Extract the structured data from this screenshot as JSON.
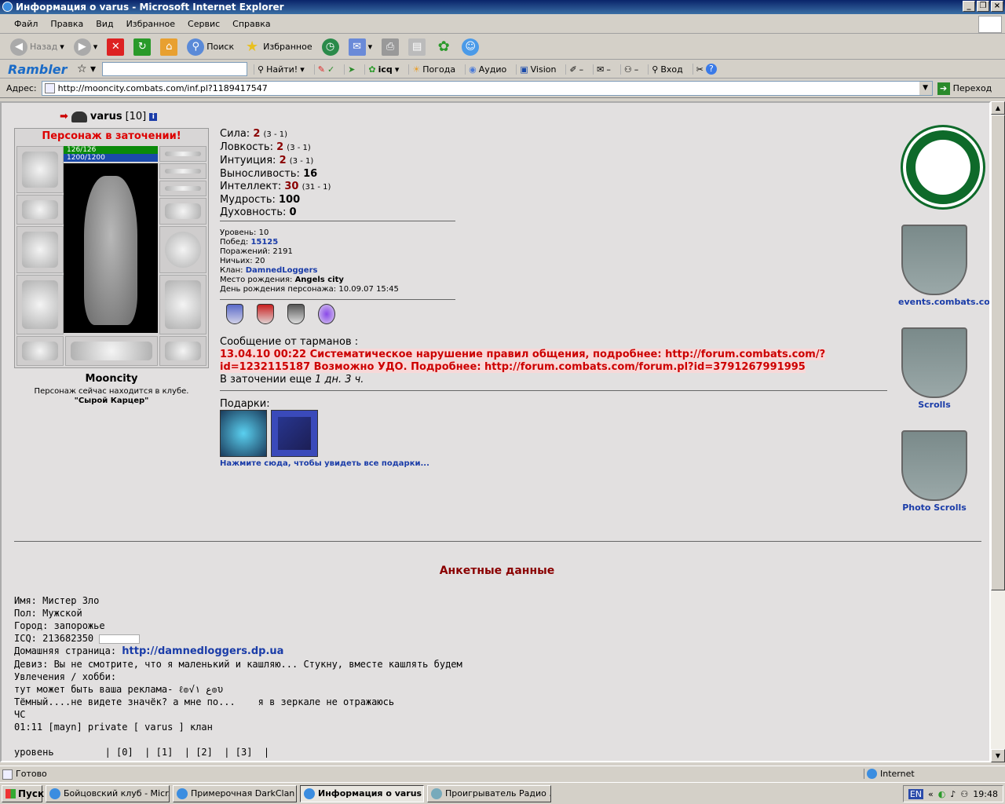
{
  "window": {
    "title": "Информация о varus - Microsoft Internet Explorer"
  },
  "menu": [
    "Файл",
    "Правка",
    "Вид",
    "Избранное",
    "Сервис",
    "Справка"
  ],
  "toolbar": {
    "back": "Назад",
    "search": "Поиск",
    "favorites": "Избранное"
  },
  "rambler": {
    "logo": "Rambler",
    "find": "Найти!",
    "icq": "icq",
    "weather": "Погода",
    "audio": "Аудио",
    "vision": "Vision",
    "login": "Вход"
  },
  "address": {
    "label": "Адрес:",
    "url": "http://mooncity.combats.com/inf.pl?1189417547",
    "go": "Переход"
  },
  "character": {
    "nick": "varus",
    "level": "[10]",
    "prison": "Персонаж в заточении!",
    "hp": "126/126",
    "mp": "1200/1200",
    "city": "Mooncity",
    "location": "Персонаж сейчас находится в клубе.",
    "room": "\"Сырой Карцер\""
  },
  "stats": [
    {
      "label": "Сила:",
      "value": "2",
      "extra": "(3 - 1)"
    },
    {
      "label": "Ловкость:",
      "value": "2",
      "extra": "(3 - 1)"
    },
    {
      "label": "Интуиция:",
      "value": "2",
      "extra": "(3 - 1)"
    },
    {
      "label": "Выносливость:",
      "value": "16",
      "extra": ""
    },
    {
      "label": "Интеллект:",
      "value": "30",
      "extra": "(31 - 1)"
    },
    {
      "label": "Мудрость:",
      "value": "100",
      "extra": ""
    },
    {
      "label": "Духовность:",
      "value": "0",
      "extra": ""
    }
  ],
  "details": {
    "level": "Уровень: 10",
    "wins_label": "Побед:",
    "wins": "15125",
    "losses": "Поражений: 2191",
    "draws": "Ничьих: 20",
    "clan_label": "Клан:",
    "clan": "DamnedLoggers",
    "birthplace_label": "Место рождения:",
    "birthplace": "Angels city",
    "birthday": "День рождения персонажа: 10.09.07 15:45"
  },
  "message": {
    "head": "Сообщение от тарманов :",
    "text1": "13.04.10 00:22 Систематическое нарушение правил общения, подробнее: http://forum.combats.com/?",
    "text2": "id=1232115187 Возможно УДО. Подробнее: http://forum.combats.com/forum.pl?id=3791267991995",
    "jail_prefix": "В заточении еще",
    "jail_time": "1 дн. 3 ч."
  },
  "gifts": {
    "label": "Подарки:",
    "link": "Нажмите сюда, чтобы увидеть все подарки..."
  },
  "banners": [
    {
      "label": "events.combats.com",
      "text": "events"
    },
    {
      "label": "Scrolls",
      "text": "scrolls"
    },
    {
      "label": "Photo Scrolls",
      "text": "photo"
    }
  ],
  "anketa": {
    "title": "Анкетные данные",
    "name": "Имя: Мистер Зло",
    "sex": "Пол: Мужской",
    "city": "Город: запорожье",
    "icq": "ICQ: 213682350",
    "homepage_label": "Домашняя страница:",
    "homepage": "http://damnedloggers.dp.ua",
    "motto": "Девиз: Вы не смотрите, что я маленький и кашляю... Стукну, вместе кашлять будем",
    "hobby": "Увлечения / хобби:",
    "line1": "тут может быть ваша реклама- ℓ๏√ع ١๏υ",
    "line2": "Тёмный....не видете значёк? а мне по...    я в зеркале не отражаюсь",
    "line3": "ЧС",
    "line4": "01:11 [mayn] private [ varus ] клан",
    "line5": "",
    "line6": "уровень         | [0]  | [1]  | [2]  | [3]  |"
  },
  "status": {
    "text": "Готово",
    "zone": "Internet"
  },
  "taskbar": {
    "start": "Пуск",
    "tasks": [
      "Бойцовский клуб - Micr...",
      "Примерочная DarkClan -...",
      "Информация о varus ...",
      "Проигрыватель Радио ..."
    ],
    "lang": "EN",
    "time": "19:48"
  }
}
